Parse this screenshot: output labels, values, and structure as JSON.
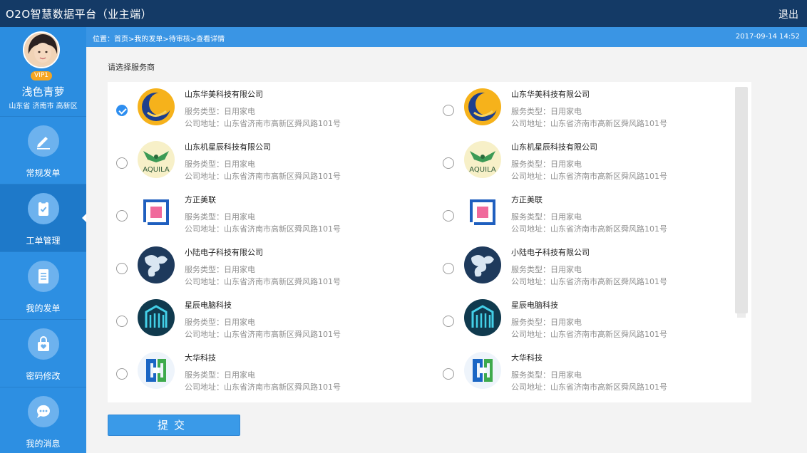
{
  "header": {
    "title": "O2O智慧数据平台（业主端）",
    "logout": "退出"
  },
  "user": {
    "vip": "VIP1",
    "name": "浅色青萝",
    "region": "山东省 济南市 高新区"
  },
  "nav": [
    {
      "label": "常规发单",
      "icon": "pen-icon"
    },
    {
      "label": "工单管理",
      "icon": "clipboard-check-icon",
      "active": true
    },
    {
      "label": "我的发单",
      "icon": "document-list-icon"
    },
    {
      "label": "密码修改",
      "icon": "lock-heart-icon"
    },
    {
      "label": "我的消息",
      "icon": "chat-bubble-icon"
    }
  ],
  "breadcrumb": "位置：首页>我的发单>待审核>查看详情",
  "datetime": "2017-09-14 14:52",
  "section_label": "请选择服务商",
  "providers_left": [
    {
      "name": "山东华美科技有限公司",
      "service": "服务类型：日用家电",
      "address": "公司地址：山东省济南市高新区舜风路101号",
      "logo": "crescent-logo",
      "checked": true
    },
    {
      "name": "山东机星辰科技有限公司",
      "service": "服务类型：日用家电",
      "address": "公司地址：山东省济南市高新区舜风路101号",
      "logo": "aquila-logo",
      "logo_text": "AQUILA"
    },
    {
      "name": "方正美联",
      "service": "服务类型：日用家电",
      "address": "公司地址：山东省济南市高新区舜风路101号",
      "logo": "square-frame-logo"
    },
    {
      "name": "小陆电子科技有限公司",
      "service": "服务类型：日用家电",
      "address": "公司地址：山东省济南市高新区舜风路101号",
      "logo": "blob-logo"
    },
    {
      "name": "星辰电脑科技",
      "service": "服务类型：日用家电",
      "address": "公司地址：山东省济南市高新区舜风路101号",
      "logo": "building-logo"
    },
    {
      "name": "大华科技",
      "service": "服务类型：日用家电",
      "address": "公司地址：山东省济南市高新区舜风路101号",
      "logo": "cross-logo"
    }
  ],
  "providers_right": [
    {
      "name": "山东华美科技有限公司",
      "service": "服务类型：日用家电",
      "address": "公司地址：山东省济南市高新区舜风路101号",
      "logo": "crescent-logo"
    },
    {
      "name": "山东机星辰科技有限公司",
      "service": "服务类型：日用家电",
      "address": "公司地址：山东省济南市高新区舜风路101号",
      "logo": "aquila-logo",
      "logo_text": "AQUILA"
    },
    {
      "name": "方正美联",
      "service": "服务类型：日用家电",
      "address": "公司地址：山东省济南市高新区舜风路101号",
      "logo": "square-frame-logo"
    },
    {
      "name": "小陆电子科技有限公司",
      "service": "服务类型：日用家电",
      "address": "公司地址：山东省济南市高新区舜风路101号",
      "logo": "blob-logo"
    },
    {
      "name": "星辰电脑科技",
      "service": "服务类型：日用家电",
      "address": "公司地址：山东省济南市高新区舜风路101号",
      "logo": "building-logo"
    },
    {
      "name": "大华科技",
      "service": "服务类型：日用家电",
      "address": "公司地址：山东省济南市高新区舜风路101号",
      "logo": "cross-logo"
    }
  ],
  "submit_label": "提交",
  "colors": {
    "header_bg": "#143a66",
    "sidebar_bg": "#2d8fe2",
    "accent": "#2e8ef0",
    "submit_bg": "#3a9ae8"
  }
}
